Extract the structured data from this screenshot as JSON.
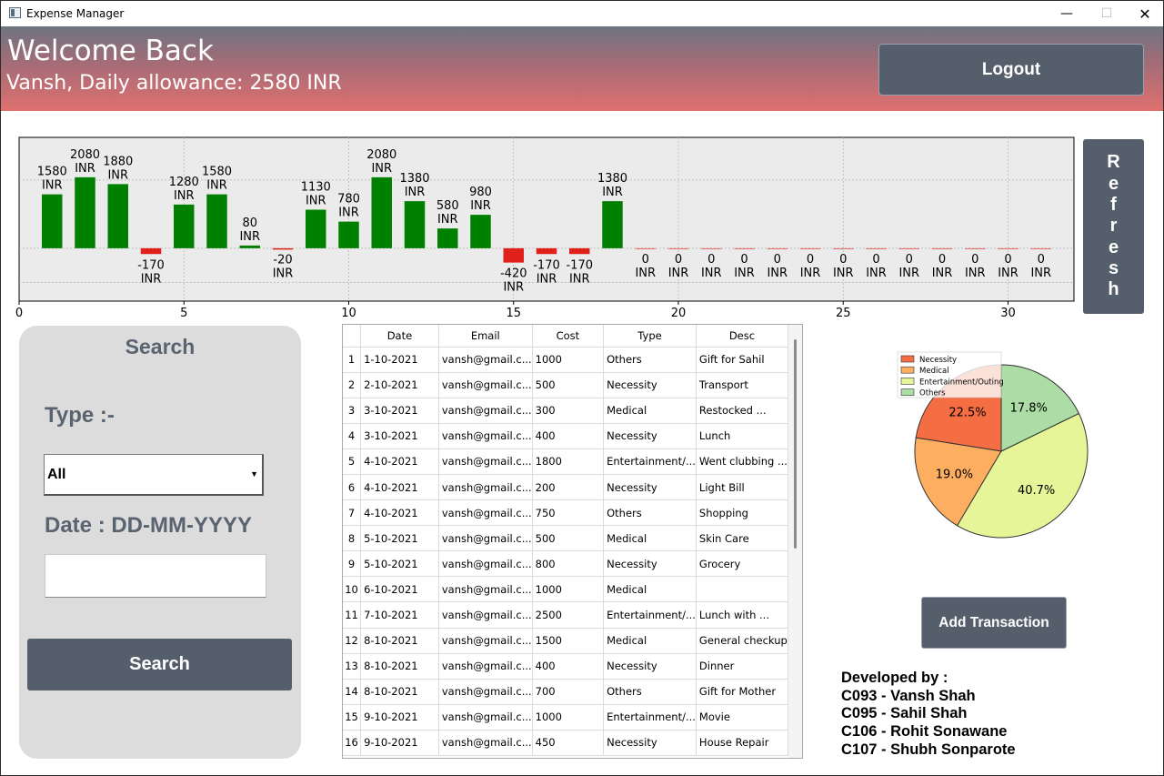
{
  "window": {
    "title": "Expense Manager",
    "minimize": "—",
    "maximize": "☐",
    "close": "✕"
  },
  "header": {
    "welcome": "Welcome Back",
    "allowance": "Vansh, Daily allowance: 2580 INR",
    "logout_label": "Logout"
  },
  "refresh_label": "Refresh",
  "chart_data": {
    "type": "bar",
    "x": [
      1,
      2,
      3,
      4,
      5,
      6,
      7,
      8,
      9,
      10,
      11,
      12,
      13,
      14,
      15,
      16,
      17,
      18,
      19,
      20,
      21,
      22,
      23,
      24,
      25,
      26,
      27,
      28,
      29,
      30,
      31
    ],
    "values": [
      1580,
      2080,
      1880,
      -170,
      1280,
      1580,
      80,
      -20,
      1130,
      780,
      2080,
      1380,
      580,
      980,
      -420,
      -170,
      -170,
      1380,
      0,
      0,
      0,
      0,
      0,
      0,
      0,
      0,
      0,
      0,
      0,
      0,
      0
    ],
    "labels": [
      "1580\nINR",
      "2080\nINR",
      "1880\nINR",
      "-170\nINR",
      "1280\nINR",
      "1580\nINR",
      "80\nINR",
      "-20\nINR",
      "1130\nINR",
      "780\nINR",
      "2080\nINR",
      "1380\nINR",
      "580\nINR",
      "980\nINR",
      "-420\nINR",
      "-170\nINR",
      "-170\nINR",
      "1380\nINR",
      "0\nINR",
      "0\nINR",
      "0\nINR",
      "0\nINR",
      "0\nINR",
      "0\nINR",
      "0\nINR",
      "0\nINR",
      "0\nINR",
      "0\nINR",
      "0\nINR",
      "0\nINR",
      "0\nINR"
    ],
    "xticks": [
      0,
      5,
      10,
      15,
      20,
      25,
      30
    ],
    "xlim": [
      0,
      32
    ],
    "ylim": [
      -1550,
      3250
    ],
    "positive_color": "#008000",
    "negative_color": "#e0201a",
    "grid": true
  },
  "search": {
    "title": "Search",
    "type_label": "Type :-",
    "type_value": "All",
    "date_label": "Date : DD-MM-YYYY",
    "date_value": "",
    "button_label": "Search"
  },
  "table": {
    "headers": [
      "Date",
      "Email",
      "Cost",
      "Type",
      "Desc"
    ],
    "rows": [
      [
        "1",
        "1-10-2021",
        "vansh@gmail.c...",
        "1000",
        "Others",
        "Gift for Sahil"
      ],
      [
        "2",
        "2-10-2021",
        "vansh@gmail.c...",
        "500",
        "Necessity",
        "Transport"
      ],
      [
        "3",
        "3-10-2021",
        "vansh@gmail.c...",
        "300",
        "Medical",
        "Restocked ..."
      ],
      [
        "4",
        "3-10-2021",
        "vansh@gmail.c...",
        "400",
        "Necessity",
        "Lunch"
      ],
      [
        "5",
        "4-10-2021",
        "vansh@gmail.c...",
        "1800",
        "Entertainment/...",
        "Went clubbing ..."
      ],
      [
        "6",
        "4-10-2021",
        "vansh@gmail.c...",
        "200",
        "Necessity",
        "Light Bill"
      ],
      [
        "7",
        "4-10-2021",
        "vansh@gmail.c...",
        "750",
        "Others",
        "Shopping"
      ],
      [
        "8",
        "5-10-2021",
        "vansh@gmail.c...",
        "500",
        "Medical",
        "Skin Care"
      ],
      [
        "9",
        "5-10-2021",
        "vansh@gmail.c...",
        "800",
        "Necessity",
        "Grocery"
      ],
      [
        "10",
        "6-10-2021",
        "vansh@gmail.c...",
        "1000",
        "Medical",
        ""
      ],
      [
        "11",
        "7-10-2021",
        "vansh@gmail.c...",
        "2500",
        "Entertainment/...",
        "Lunch with ..."
      ],
      [
        "12",
        "8-10-2021",
        "vansh@gmail.c...",
        "1500",
        "Medical",
        "General checkup"
      ],
      [
        "13",
        "8-10-2021",
        "vansh@gmail.c...",
        "400",
        "Necessity",
        "Dinner"
      ],
      [
        "14",
        "8-10-2021",
        "vansh@gmail.c...",
        "700",
        "Others",
        "Gift for Mother"
      ],
      [
        "15",
        "9-10-2021",
        "vansh@gmail.c...",
        "1000",
        "Entertainment/...",
        "Movie"
      ],
      [
        "16",
        "9-10-2021",
        "vansh@gmail.c...",
        "450",
        "Necessity",
        "House Repair"
      ]
    ]
  },
  "pie": {
    "legend": [
      "Necessity",
      "Medical",
      "Entertainment/Outing",
      "Others"
    ],
    "slices": [
      {
        "name": "Necessity",
        "pct": 22.5,
        "label": "22.5%",
        "color": "#f46d43"
      },
      {
        "name": "Medical",
        "pct": 19.0,
        "label": "19.0%",
        "color": "#fdae61"
      },
      {
        "name": "Entertainment/Outing",
        "pct": 40.7,
        "label": "40.7%",
        "color": "#e6f598"
      },
      {
        "name": "Others",
        "pct": 17.8,
        "label": "17.8%",
        "color": "#abdda4"
      }
    ]
  },
  "add_transaction_label": "Add Transaction",
  "credits": [
    "Developed by :",
    "C093 - Vansh Shah",
    "C095 - Sahil Shah",
    "C106 - Rohit Sonawane",
    "C107 - Shubh Sonparote"
  ]
}
